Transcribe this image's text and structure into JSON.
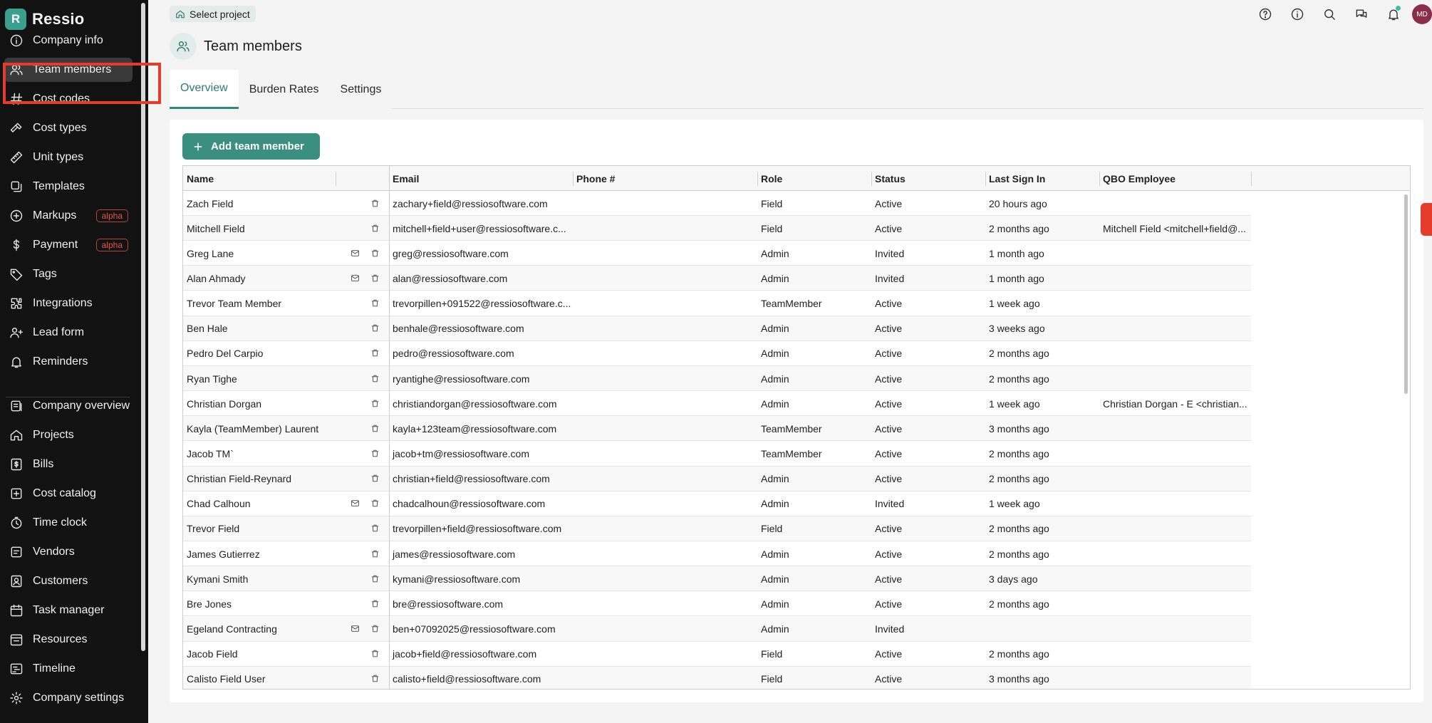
{
  "brand": {
    "name": "Ressio",
    "logo_letter": "R"
  },
  "sidebar": {
    "items": [
      {
        "label": "Company info",
        "icon": "info-icon"
      },
      {
        "label": "Team members",
        "icon": "users-icon",
        "active": true
      },
      {
        "label": "Cost codes",
        "icon": "hash-icon"
      },
      {
        "label": "Cost types",
        "icon": "hammer-icon"
      },
      {
        "label": "Unit types",
        "icon": "ruler-icon"
      },
      {
        "label": "Templates",
        "icon": "template-icon"
      },
      {
        "label": "Markups",
        "icon": "markup-icon",
        "badge": "alpha"
      },
      {
        "label": "Payment",
        "icon": "dollar-icon",
        "badge": "alpha"
      },
      {
        "label": "Tags",
        "icon": "tag-icon"
      },
      {
        "label": "Integrations",
        "icon": "puzzle-icon"
      },
      {
        "label": "Lead form",
        "icon": "user-plus-icon"
      },
      {
        "label": "Reminders",
        "icon": "bell-icon"
      },
      {
        "label": "Company overview",
        "icon": "overview-icon"
      },
      {
        "label": "Projects",
        "icon": "home-icon"
      },
      {
        "label": "Bills",
        "icon": "bill-icon"
      },
      {
        "label": "Cost catalog",
        "icon": "catalog-icon"
      },
      {
        "label": "Time clock",
        "icon": "clock-icon"
      },
      {
        "label": "Vendors",
        "icon": "vendor-icon"
      },
      {
        "label": "Customers",
        "icon": "customer-icon"
      },
      {
        "label": "Task manager",
        "icon": "calendar-icon"
      },
      {
        "label": "Resources",
        "icon": "resources-icon"
      },
      {
        "label": "Timeline",
        "icon": "timeline-icon"
      },
      {
        "label": "Company settings",
        "icon": "gear-icon"
      }
    ]
  },
  "topbar": {
    "select_project": "Select project",
    "avatar_initials": "MD"
  },
  "page": {
    "title": "Team members"
  },
  "tabs": [
    {
      "label": "Overview",
      "active": true
    },
    {
      "label": "Burden Rates"
    },
    {
      "label": "Settings"
    }
  ],
  "actions": {
    "add_label": "Add team member"
  },
  "table": {
    "columns": [
      "Name",
      "Email",
      "Phone #",
      "Role",
      "Status",
      "Last Sign In",
      "QBO Employee"
    ],
    "rows": [
      {
        "name": "Zach Field",
        "email": "zachary+field@ressiosoftware.com",
        "phone": "",
        "role": "Field",
        "status": "Active",
        "last": "20 hours ago",
        "qbo": "",
        "mail": false
      },
      {
        "name": "Mitchell Field",
        "email": "mitchell+field+user@ressiosoftware.c...",
        "phone": "",
        "role": "Field",
        "status": "Active",
        "last": "2 months ago",
        "qbo": "Mitchell Field <mitchell+field@...",
        "mail": false
      },
      {
        "name": "Greg Lane",
        "email": "greg@ressiosoftware.com",
        "phone": "",
        "role": "Admin",
        "status": "Invited",
        "last": "1 month ago",
        "qbo": "",
        "mail": true
      },
      {
        "name": "Alan Ahmady",
        "email": "alan@ressiosoftware.com",
        "phone": "",
        "role": "Admin",
        "status": "Invited",
        "last": "1 month ago",
        "qbo": "",
        "mail": true
      },
      {
        "name": "Trevor Team Member",
        "email": "trevorpillen+091522@ressiosoftware.c...",
        "phone": "",
        "role": "TeamMember",
        "status": "Active",
        "last": "1 week ago",
        "qbo": "",
        "mail": false
      },
      {
        "name": "Ben Hale",
        "email": "benhale@ressiosoftware.com",
        "phone": "",
        "role": "Admin",
        "status": "Active",
        "last": "3 weeks ago",
        "qbo": "",
        "mail": false
      },
      {
        "name": "Pedro Del Carpio",
        "email": "pedro@ressiosoftware.com",
        "phone": "",
        "role": "Admin",
        "status": "Active",
        "last": "2 months ago",
        "qbo": "",
        "mail": false
      },
      {
        "name": "Ryan Tighe",
        "email": "ryantighe@ressiosoftware.com",
        "phone": "",
        "role": "Admin",
        "status": "Active",
        "last": "2 months ago",
        "qbo": "",
        "mail": false
      },
      {
        "name": "Christian Dorgan",
        "email": "christiandorgan@ressiosoftware.com",
        "phone": "",
        "role": "Admin",
        "status": "Active",
        "last": "1 week ago",
        "qbo": "Christian Dorgan - E <christian...",
        "mail": false
      },
      {
        "name": "Kayla (TeamMember) Laurent",
        "email": "kayla+123team@ressiosoftware.com",
        "phone": "",
        "role": "TeamMember",
        "status": "Active",
        "last": "3 months ago",
        "qbo": "",
        "mail": false
      },
      {
        "name": "Jacob TM`",
        "email": "jacob+tm@ressiosoftware.com",
        "phone": "",
        "role": "TeamMember",
        "status": "Active",
        "last": "2 months ago",
        "qbo": "",
        "mail": false
      },
      {
        "name": "Christian Field-Reynard",
        "email": "christian+field@ressiosoftware.com",
        "phone": "",
        "role": "Admin",
        "status": "Active",
        "last": "2 months ago",
        "qbo": "",
        "mail": false
      },
      {
        "name": "Chad Calhoun",
        "email": "chadcalhoun@ressiosoftware.com",
        "phone": "",
        "role": "Admin",
        "status": "Invited",
        "last": "1 week ago",
        "qbo": "",
        "mail": true
      },
      {
        "name": "Trevor Field",
        "email": "trevorpillen+field@ressiosoftware.com",
        "phone": "",
        "role": "Field",
        "status": "Active",
        "last": "2 months ago",
        "qbo": "",
        "mail": false
      },
      {
        "name": "James Gutierrez",
        "email": "james@ressiosoftware.com",
        "phone": "",
        "role": "Admin",
        "status": "Active",
        "last": "2 months ago",
        "qbo": "",
        "mail": false
      },
      {
        "name": "Kymani Smith",
        "email": "kymani@ressiosoftware.com",
        "phone": "",
        "role": "Admin",
        "status": "Active",
        "last": "3 days ago",
        "qbo": "",
        "mail": false
      },
      {
        "name": "Bre Jones",
        "email": "bre@ressiosoftware.com",
        "phone": "",
        "role": "Admin",
        "status": "Active",
        "last": "2 months ago",
        "qbo": "",
        "mail": false
      },
      {
        "name": "Egeland Contracting",
        "email": "ben+07092025@ressiosoftware.com",
        "phone": "",
        "role": "Admin",
        "status": "Invited",
        "last": "",
        "qbo": "",
        "mail": true
      },
      {
        "name": "Jacob Field",
        "email": "jacob+field@ressiosoftware.com",
        "phone": "",
        "role": "Field",
        "status": "Active",
        "last": "2 months ago",
        "qbo": "",
        "mail": false
      },
      {
        "name": "Calisto Field User",
        "email": "calisto+field@ressiosoftware.com",
        "phone": "",
        "role": "Field",
        "status": "Active",
        "last": "3 months ago",
        "qbo": "",
        "mail": false
      }
    ]
  },
  "colors": {
    "accent": "#3a8f80",
    "sidebar_bg": "#121212",
    "highlight": "#e43b2b"
  }
}
